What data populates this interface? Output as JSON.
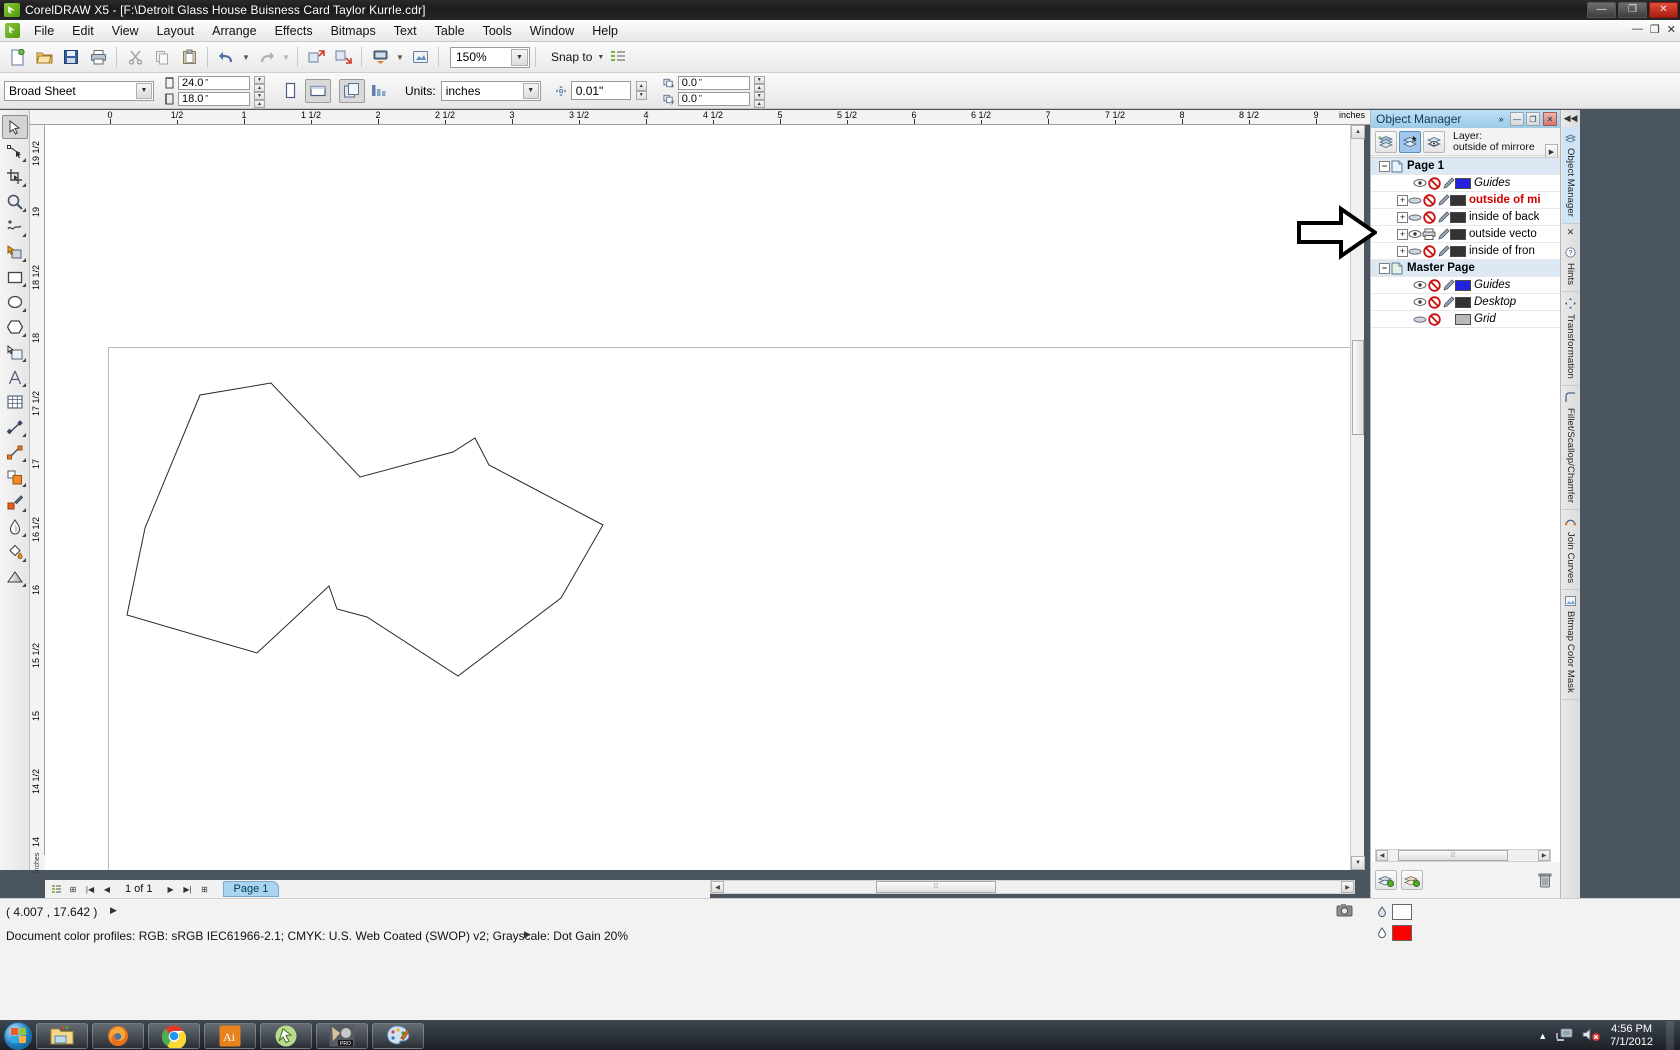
{
  "window": {
    "title": "CorelDRAW X5 - [F:\\Detroit Glass House Buisness Card Taylor Kurrle.cdr]",
    "minimize": "—",
    "maximize": "❐",
    "close": "✕",
    "doc_minimize": "—",
    "doc_restore": "❐",
    "doc_close": "✕"
  },
  "menu": {
    "items": [
      {
        "label": "File"
      },
      {
        "label": "Edit"
      },
      {
        "label": "View"
      },
      {
        "label": "Layout"
      },
      {
        "label": "Arrange"
      },
      {
        "label": "Effects"
      },
      {
        "label": "Bitmaps"
      },
      {
        "label": "Text"
      },
      {
        "label": "Table"
      },
      {
        "label": "Tools"
      },
      {
        "label": "Window"
      },
      {
        "label": "Help"
      }
    ]
  },
  "toolbar_standard": {
    "zoom_level": "150%",
    "snap_to_label": "Snap to",
    "buttons": [
      {
        "name": "new-document",
        "icon": "new-doc-icon"
      },
      {
        "name": "open-document",
        "icon": "open-folder-icon"
      },
      {
        "name": "save-document",
        "icon": "save-disk-icon"
      },
      {
        "name": "print-document",
        "icon": "printer-icon"
      },
      {
        "name": "cut",
        "icon": "scissors-icon"
      },
      {
        "name": "copy",
        "icon": "copy-icon"
      },
      {
        "name": "paste",
        "icon": "clipboard-icon"
      },
      {
        "name": "undo",
        "icon": "undo-arrow-icon"
      },
      {
        "name": "redo",
        "icon": "redo-arrow-icon"
      },
      {
        "name": "import",
        "icon": "import-icon"
      },
      {
        "name": "export",
        "icon": "export-icon"
      },
      {
        "name": "launch-application",
        "icon": "launch-icon"
      },
      {
        "name": "corel-connect",
        "icon": "connect-icon"
      }
    ]
  },
  "property_bar": {
    "paper_type": "Broad Sheet",
    "page_width": "24.0",
    "page_height": "18.0",
    "unit_mark": "\"",
    "units_label": "Units:",
    "units_value": "inches",
    "nudge_value": "0.01",
    "duplicate_x": "0.0",
    "duplicate_y": "0.0",
    "orientation_portrait": "portrait-icon",
    "orientation_landscape": "landscape-icon"
  },
  "toolbox": {
    "tools": [
      {
        "name": "pick-tool",
        "icon": "cursor-arrow-icon",
        "selected": true
      },
      {
        "name": "shape-tool",
        "icon": "node-edit-icon",
        "selected": false
      },
      {
        "name": "crop-tool",
        "icon": "crop-icon",
        "selected": false
      },
      {
        "name": "zoom-tool",
        "icon": "magnifier-icon",
        "selected": false
      },
      {
        "name": "freehand-tool",
        "icon": "freehand-curve-icon",
        "selected": false
      },
      {
        "name": "smart-fill-tool",
        "icon": "smart-fill-icon",
        "selected": false
      },
      {
        "name": "rectangle-tool",
        "icon": "rectangle-icon",
        "selected": false
      },
      {
        "name": "ellipse-tool",
        "icon": "ellipse-icon",
        "selected": false
      },
      {
        "name": "polygon-tool",
        "icon": "polygon-icon",
        "selected": false
      },
      {
        "name": "basic-shapes-tool",
        "icon": "basic-shapes-icon",
        "selected": false
      },
      {
        "name": "text-tool",
        "icon": "letter-a-icon",
        "selected": false
      },
      {
        "name": "table-tool",
        "icon": "table-grid-icon",
        "selected": false
      },
      {
        "name": "dimension-tool",
        "icon": "dimension-line-icon",
        "selected": false
      },
      {
        "name": "connector-tool",
        "icon": "connector-line-icon",
        "selected": false
      },
      {
        "name": "blend-tool",
        "icon": "blend-shapes-icon",
        "selected": false
      },
      {
        "name": "color-eyedropper-tool",
        "icon": "eyedropper-icon",
        "selected": false
      },
      {
        "name": "outline-tool",
        "icon": "outline-pen-icon",
        "selected": false
      },
      {
        "name": "fill-tool",
        "icon": "paint-bucket-icon",
        "selected": false
      },
      {
        "name": "interactive-fill-tool",
        "icon": "interactive-fill-icon",
        "selected": false
      }
    ]
  },
  "rulers": {
    "unit_corner": "inches",
    "horizontal_labels": [
      "0",
      "1/2",
      "1",
      "1 1/2",
      "2",
      "2 1/2",
      "3",
      "3 1/2",
      "4",
      "4 1/2",
      "5",
      "5 1/2",
      "6",
      "6 1/2",
      "7",
      "7 1/2",
      "8",
      "8 1/2",
      "9"
    ],
    "horizontal_unit": "inches",
    "vertical_labels": [
      "19 1/2",
      "19",
      "18 1/2",
      "18",
      "17 1/2",
      "17",
      "16 1/2",
      "16",
      "15 1/2",
      "15",
      "14 1/2",
      "14"
    ]
  },
  "page_nav": {
    "page_counter": "1 of 1",
    "page_tab": "Page 1",
    "first": "|◀",
    "prev": "◀",
    "next": "▶",
    "last": "▶|",
    "add_page_left": "⊞",
    "add_page_right": "⊞"
  },
  "status_bar": {
    "coordinates": "( 4.007 , 17.642 )",
    "coord_arrow": "▶",
    "color_profiles": "Document color profiles: RGB: sRGB IEC61966-2.1; CMYK: U.S. Web Coated (SWOP) v2; Grayscale: Dot Gain 20%",
    "profiles_arrow": "▶",
    "fill_label": "",
    "outline_label": "",
    "fill_swatch": "#ffffff",
    "outline_swatch": "#ff0000"
  },
  "object_manager": {
    "title": "Object Manager",
    "chevron": "»",
    "minimize": "—",
    "maximize": "❐",
    "close": "✕",
    "layer_label_line1": "Layer:",
    "layer_label_line2": "outside of mirrore",
    "tool_buttons": [
      {
        "name": "show-object-properties",
        "icon": "object-properties-icon",
        "active": false
      },
      {
        "name": "edit-across-layers",
        "icon": "edit-across-layers-icon",
        "active": true
      },
      {
        "name": "layer-manager-view",
        "icon": "layer-manager-icon",
        "active": false
      }
    ],
    "tree": [
      {
        "type": "page",
        "label": "Page 1",
        "expander": "−",
        "icon": "page-icon"
      },
      {
        "type": "layer",
        "label": "Guides",
        "italic": true,
        "color": "#2222dd",
        "expander": "",
        "eye": "visible",
        "print": "no-print",
        "lock": "unlocked"
      },
      {
        "type": "layer",
        "label": "outside of mi",
        "red": true,
        "color": "#333333",
        "expander": "+",
        "eye": "hidden",
        "print": "no-print",
        "lock": "unlocked"
      },
      {
        "type": "layer",
        "label": "inside of back",
        "color": "#333333",
        "expander": "+",
        "eye": "hidden",
        "print": "no-print",
        "lock": "unlocked"
      },
      {
        "type": "layer",
        "label": "outside vecto",
        "color": "#333333",
        "expander": "+",
        "eye": "visible",
        "print": "print",
        "lock": "unlocked"
      },
      {
        "type": "layer",
        "label": "inside of fron",
        "color": "#333333",
        "expander": "+",
        "eye": "hidden",
        "print": "no-print",
        "lock": "unlocked"
      },
      {
        "type": "page",
        "label": "Master Page",
        "expander": "−",
        "icon": "page-icon"
      },
      {
        "type": "layer",
        "label": "Guides",
        "italic": true,
        "color": "#2222dd",
        "expander": "",
        "eye": "visible",
        "print": "no-print",
        "lock": "unlocked"
      },
      {
        "type": "layer",
        "label": "Desktop",
        "italic": true,
        "color": "#333333",
        "expander": "",
        "eye": "visible",
        "print": "no-print",
        "lock": "unlocked"
      },
      {
        "type": "layer",
        "label": "Grid",
        "italic": true,
        "color": "#b8b8b8",
        "expander": "",
        "eye": "hidden",
        "print": "no-print",
        "lock": "locked"
      }
    ],
    "bottom_buttons": [
      {
        "name": "new-layer-button",
        "icon": "new-layer-icon"
      },
      {
        "name": "new-master-layer-button",
        "icon": "new-master-layer-icon"
      }
    ],
    "delete_button": {
      "name": "delete-layer-button",
      "icon": "trash-icon"
    }
  },
  "docker_tabs": [
    {
      "label": "Object Manager",
      "active": true,
      "icon": "object-manager-icon"
    },
    {
      "label": "Hints",
      "active": false,
      "icon": "hints-icon"
    },
    {
      "label": "Transformation",
      "active": false,
      "icon": "transformation-icon"
    },
    {
      "label": "Fillet/Scallop/Chamfer",
      "active": false,
      "icon": "fillet-icon"
    },
    {
      "label": "Join Curves",
      "active": false,
      "icon": "join-curves-icon"
    },
    {
      "label": "Bitmap Color Mask",
      "active": false,
      "icon": "bitmap-mask-icon"
    }
  ],
  "taskbar": {
    "start": "start-orb-icon",
    "items": [
      {
        "name": "windows-explorer",
        "icon": "folder-icon"
      },
      {
        "name": "firefox",
        "icon": "firefox-icon"
      },
      {
        "name": "google-chrome",
        "icon": "chrome-icon"
      },
      {
        "name": "adobe-illustrator",
        "icon": "illustrator-icon",
        "label": "Ai"
      },
      {
        "name": "coreldraw",
        "icon": "coreldraw-icon"
      },
      {
        "name": "vinyl-cutter-pro",
        "icon": "pro-app-icon",
        "label": "PRO"
      },
      {
        "name": "paint-app",
        "icon": "palette-icon"
      }
    ],
    "tray": {
      "show_hidden": "▲",
      "network_icon": "network-icon",
      "volume_icon": "volume-muted-icon",
      "time": "4:56 PM",
      "date": "7/1/2012"
    }
  },
  "annotation": {
    "arrow": "right-arrow-annotation"
  }
}
